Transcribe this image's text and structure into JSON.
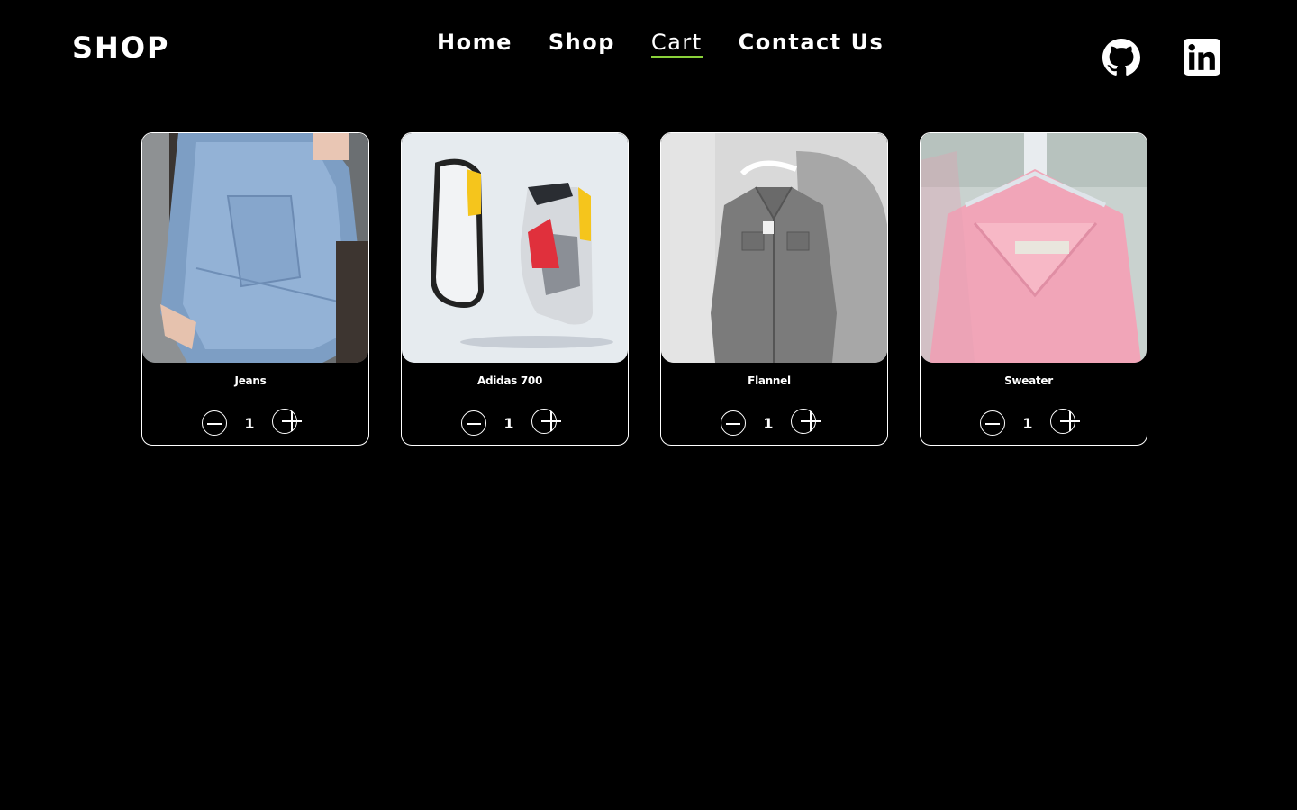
{
  "header": {
    "logo": "SHOP",
    "nav": [
      {
        "label": "Home",
        "active": false
      },
      {
        "label": "Shop",
        "active": false
      },
      {
        "label": "Cart",
        "active": true
      },
      {
        "label": "Contact Us",
        "active": false
      }
    ],
    "accent_color": "#8ad13a",
    "social_icons": [
      "github-icon",
      "linkedin-icon"
    ]
  },
  "cart": {
    "items": [
      {
        "name": "Jeans",
        "quantity": "1",
        "image": "jeans-photo"
      },
      {
        "name": "Adidas 700",
        "quantity": "1",
        "image": "sneakers-photo"
      },
      {
        "name": "Flannel",
        "quantity": "1",
        "image": "flannel-photo"
      },
      {
        "name": "Sweater",
        "quantity": "1",
        "image": "sweater-photo"
      }
    ]
  }
}
